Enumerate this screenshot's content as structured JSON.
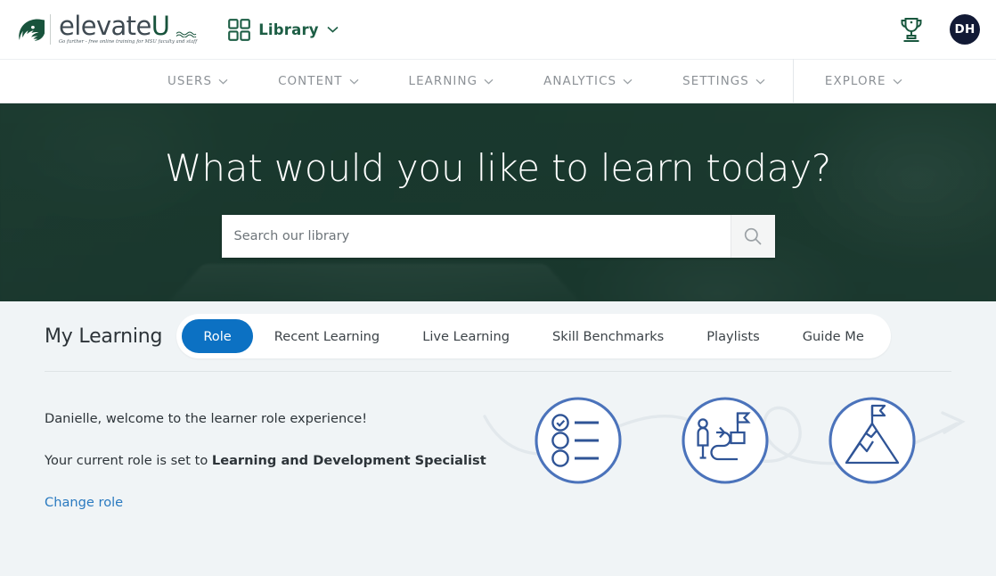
{
  "brand": {
    "logo_word": "elevate",
    "logo_u": "U",
    "tagline": "Go further - free online training for MSU faculty and staff",
    "spartan_icon": "spartan-helmet-icon"
  },
  "topbar": {
    "library_label": "Library",
    "library_icon": "grid-icon",
    "library_chevron": "chevron-down-icon",
    "trophy_icon": "trophy-icon",
    "avatar_initials": "DH"
  },
  "nav": {
    "primary": [
      {
        "label": "USERS",
        "chevron": "chevron-down-icon"
      },
      {
        "label": "CONTENT",
        "chevron": "chevron-down-icon"
      },
      {
        "label": "LEARNING",
        "chevron": "chevron-down-icon"
      },
      {
        "label": "ANALYTICS",
        "chevron": "chevron-down-icon"
      },
      {
        "label": "SETTINGS",
        "chevron": "chevron-down-icon"
      }
    ],
    "secondary": [
      {
        "label": "EXPLORE",
        "chevron": "chevron-down-icon"
      }
    ]
  },
  "hero": {
    "title": "What would you like to learn today?",
    "search_placeholder": "Search our library",
    "search_value": "",
    "search_icon": "search-icon"
  },
  "my_learning": {
    "title": "My Learning",
    "tabs": [
      {
        "label": "Role",
        "active": true
      },
      {
        "label": "Recent Learning",
        "active": false
      },
      {
        "label": "Live Learning",
        "active": false
      },
      {
        "label": "Skill Benchmarks",
        "active": false
      },
      {
        "label": "Playlists",
        "active": false
      },
      {
        "label": "Guide Me",
        "active": false
      }
    ]
  },
  "role_panel": {
    "welcome": "Danielle, welcome to the learner role experience!",
    "current_role_prefix": "Your current role is set to ",
    "current_role_name": "Learning and Development Specialist",
    "change_role_link": "Change role",
    "journey_icons": [
      "checklist-icon",
      "person-path-flag-icon",
      "mountain-flag-icon"
    ]
  },
  "colors": {
    "brand_green": "#18533c",
    "hero_green": "#1d352c",
    "accent_blue": "#0c71c3",
    "link_blue": "#2a7ac0",
    "avatar_navy": "#121a35",
    "page_bg": "#f0f4f6",
    "journey_blue": "#3f6bb5"
  }
}
